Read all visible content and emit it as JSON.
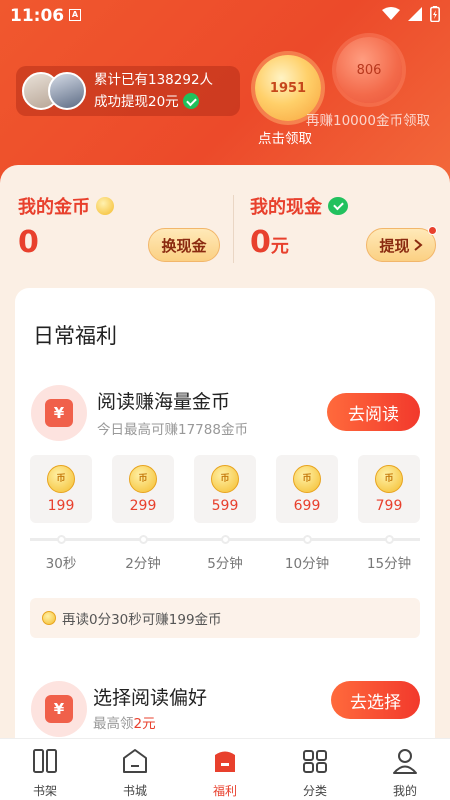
{
  "status_bar": {
    "time": "11:06",
    "app_icon": "A"
  },
  "promo": {
    "line1": "累计已有138292人",
    "line2": "成功提现20元",
    "coin1_value": "1951",
    "coin1_caption": "点击领取",
    "coin2_value": "806",
    "coin2_caption": "再赚10000金币领取"
  },
  "wallet": {
    "coins_label": "我的金币",
    "coins_value": "0",
    "exchange_label": "换现金",
    "cash_label": "我的现金",
    "cash_value": "0",
    "cash_unit": "元",
    "withdraw_label": "提现"
  },
  "daily": {
    "title": "日常福利",
    "read_task": {
      "icon": "¥",
      "title": "阅读赚海量金币",
      "subtitle": "今日最高可赚17788金币",
      "button": "去阅读"
    },
    "tiles": [
      {
        "coin": "币",
        "value": "199",
        "time": "30秒"
      },
      {
        "coin": "币",
        "value": "299",
        "time": "2分钟"
      },
      {
        "coin": "币",
        "value": "599",
        "time": "5分钟"
      },
      {
        "coin": "币",
        "value": "699",
        "time": "10分钟"
      },
      {
        "coin": "币",
        "value": "799",
        "time": "15分钟"
      }
    ],
    "tip": "再读0分30秒可赚199金币",
    "pref_task": {
      "icon": "¥",
      "title": "选择阅读偏好",
      "subtitle_prefix": "最高领",
      "subtitle_highlight": "2元",
      "button": "去选择"
    }
  },
  "tabbar": {
    "items": [
      {
        "label": "书架",
        "icon": "bookshelf-icon",
        "active": false
      },
      {
        "label": "书城",
        "icon": "bookstore-icon",
        "active": false
      },
      {
        "label": "福利",
        "icon": "welfare-icon",
        "active": true
      },
      {
        "label": "分类",
        "icon": "category-icon",
        "active": false
      },
      {
        "label": "我的",
        "icon": "profile-icon",
        "active": false
      }
    ]
  },
  "colors": {
    "accent": "#e8402d",
    "hero": "#ec4a2a",
    "sheet": "#fbefe4"
  }
}
